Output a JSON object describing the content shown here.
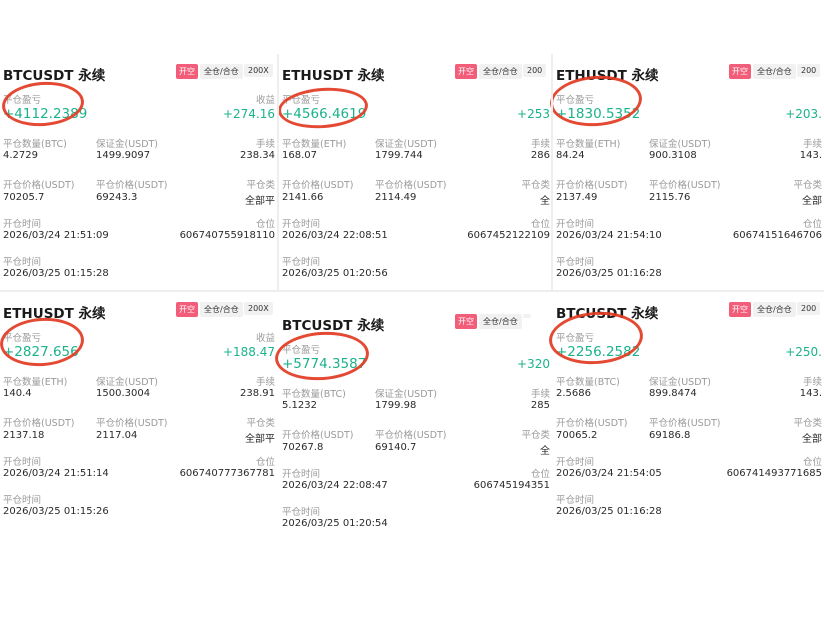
{
  "labels": {
    "open": "开空",
    "mode": "全仓/合仓",
    "pnl": "平仓盈亏",
    "earnings": "收益",
    "fee": "手续",
    "margin": "保证金(USDT)",
    "open_price": "开仓价格(USDT)",
    "close_price": "平仓价格(USDT)",
    "close_type": "平仓类",
    "position": "仓位",
    "open_time": "开仓时间",
    "close_time": "平仓时间"
  },
  "cards": [
    {
      "symbol": "BTCUSDT 永续",
      "mode": "全仓/合仓",
      "lev": "200X",
      "pnl_label": "平仓盈亏",
      "pnl": "+4112.2389",
      "earn_label": "收益",
      "earn": "+274.16",
      "qty_label": "平仓数量(BTC)",
      "qty": "4.2729",
      "margin": "1499.9097",
      "fee": "238.34",
      "open_price": "70205.7",
      "close_price": "69243.3",
      "close_type": "全部平",
      "open_time": "2026/03/24 21:51:09",
      "position": "606740755918110",
      "close_time": "2026/03/25 01:15:28"
    },
    {
      "symbol": "ETHUSDT 永续",
      "mode": "全仓/合仓",
      "lev": "200",
      "pnl_label": "平仓盈亏",
      "pnl": "+4566.4619",
      "earn_label": "",
      "earn": "+253",
      "qty_label": "平仓数量(ETH)",
      "qty": "168.07",
      "margin": "1799.744",
      "fee": "286",
      "open_price": "2141.66",
      "close_price": "2114.49",
      "close_type": "全",
      "open_time": "2026/03/24 22:08:51",
      "position": "6067452122109",
      "close_time": "2026/03/25 01:20:56"
    },
    {
      "symbol": "ETHUSDT 永续",
      "mode": "全仓/合仓",
      "lev": "200",
      "pnl_label": "平仓盈亏",
      "pnl": "+1830.5352",
      "earn_label": "",
      "earn": "+203.",
      "qty_label": "平仓数量(ETH)",
      "qty": "84.24",
      "margin": "900.3108",
      "fee": "143.",
      "open_price": "2137.49",
      "close_price": "2115.76",
      "close_type": "全部",
      "open_time": "2026/03/24 21:54:10",
      "position": "60674151646706",
      "close_time": "2026/03/25 01:16:28"
    },
    {
      "symbol": "ETHUSDT 永续",
      "mode": "全仓/合仓",
      "lev": "200X",
      "pnl_label": "平仓盈亏",
      "pnl": "+2827.656",
      "earn_label": "收益",
      "earn": "+188.47",
      "qty_label": "平仓数量(ETH)",
      "qty": "140.4",
      "margin": "1500.3004",
      "fee": "238.91",
      "open_price": "2137.18",
      "close_price": "2117.04",
      "close_type": "全部平",
      "open_time": "2026/03/24 21:51:14",
      "position": "606740777367781",
      "close_time": "2026/03/25 01:15:26"
    },
    {
      "symbol": "BTCUSDT 永续",
      "mode": "全仓/合仓",
      "lev": "",
      "pnl_label": "平仓盈亏",
      "pnl": "+5774.3587",
      "earn_label": "",
      "earn": "+320",
      "qty_label": "平仓数量(BTC)",
      "qty": "5.1232",
      "margin": "1799.98",
      "fee": "285",
      "open_price": "70267.8",
      "close_price": "69140.7",
      "close_type": "全",
      "open_time": "2026/03/24 22:08:47",
      "position": "606745194351",
      "close_time": "2026/03/25 01:20:54"
    },
    {
      "symbol": "BTCUSDT 永续",
      "mode": "全仓/合仓",
      "lev": "200",
      "pnl_label": "平仓盈亏",
      "pnl": "+2256.2582",
      "earn_label": "",
      "earn": "+250.",
      "qty_label": "平仓数量(BTC)",
      "qty": "2.5686",
      "margin": "899.8474",
      "fee": "143.",
      "open_price": "70065.2",
      "close_price": "69186.8",
      "close_type": "全部",
      "open_time": "2026/03/24 21:54:05",
      "position": "606741493771685",
      "close_time": "2026/03/25 01:16:28"
    }
  ]
}
